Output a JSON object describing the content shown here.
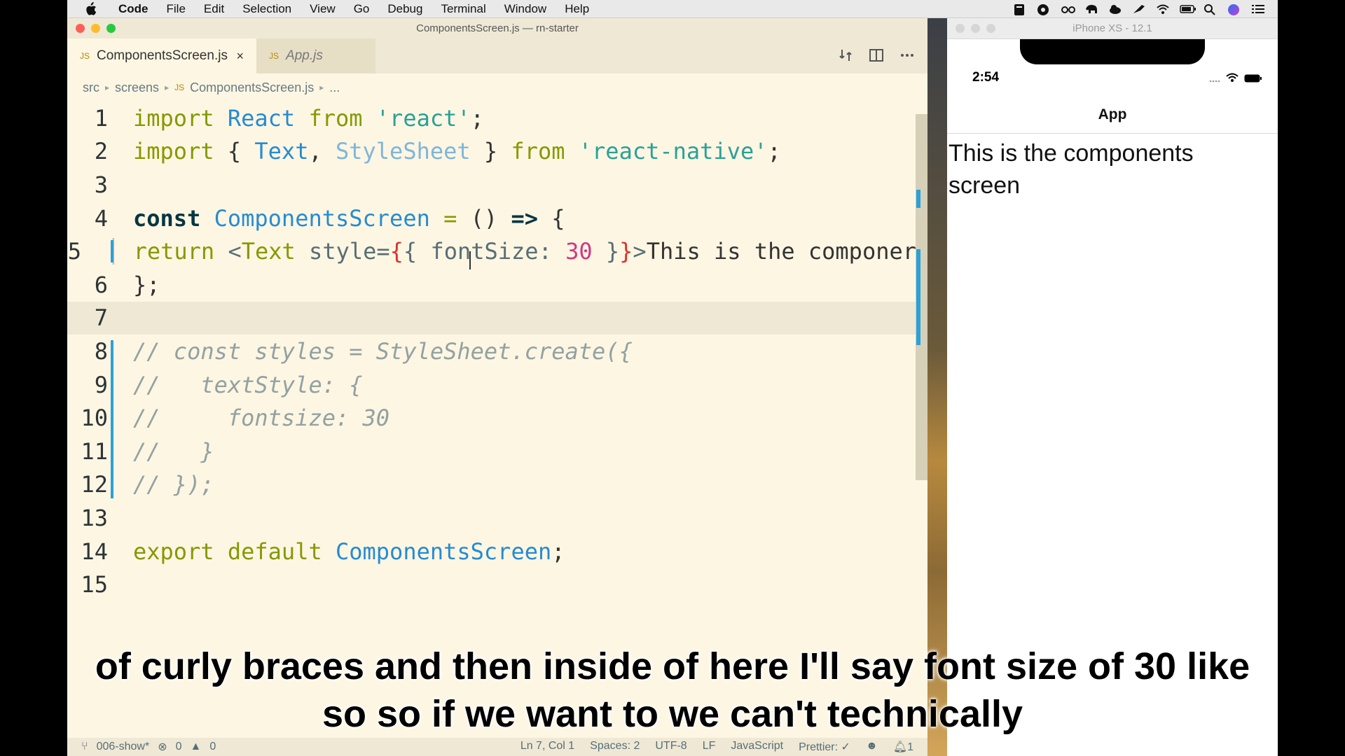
{
  "menubar": {
    "app": "Code",
    "items": [
      "File",
      "Edit",
      "Selection",
      "View",
      "Go",
      "Debug",
      "Terminal",
      "Window",
      "Help"
    ]
  },
  "editor": {
    "window_title": "ComponentsScreen.js — rn-starter",
    "tabs": [
      {
        "label": "ComponentsScreen.js",
        "close": "×"
      },
      {
        "label": "App.js"
      }
    ],
    "tab_badge": "JS",
    "breadcrumb": [
      "src",
      "screens",
      "ComponentsScreen.js",
      "..."
    ],
    "line_numbers": [
      "1",
      "2",
      "3",
      "4",
      "5",
      "6",
      "7",
      "8",
      "9",
      "10",
      "11",
      "12",
      "13",
      "14",
      "15"
    ],
    "code": {
      "l1": [
        "import",
        " React ",
        "from",
        " 'react'",
        ";"
      ],
      "l2": [
        "import",
        " { ",
        "Text",
        ", ",
        "StyleSheet",
        " } ",
        "from",
        " 'react-native'",
        ";"
      ],
      "l4": [
        "const",
        " ComponentsScreen",
        " = ",
        "() ",
        "=>",
        " {"
      ],
      "l5": [
        "return",
        " <",
        "Text",
        " style=",
        "{",
        "{ fontSize: ",
        "30",
        " }",
        "}",
        ">",
        "This is the componer"
      ],
      "l6": "};",
      "l8": "// const styles = StyleSheet.create({",
      "l9": "//   textStyle: {",
      "l10": "//     fontsize: 30",
      "l11": "//   }",
      "l12": "// });",
      "l14": [
        "export",
        " default",
        " ComponentsScreen",
        ";"
      ]
    },
    "status": {
      "branch": "006-show*",
      "errors": "0",
      "warnings": "0",
      "position": "Ln 7, Col 1",
      "spaces": "Spaces: 2",
      "encoding": "UTF-8",
      "eol": "LF",
      "language": "JavaScript",
      "prettier": "Prettier: ✓",
      "notifications": "1"
    }
  },
  "simulator": {
    "title": "iPhone XS - 12.1",
    "time": "2:54",
    "nav_title": "App",
    "screen_text": "This is the components screen"
  },
  "subtitles": {
    "line1": "of curly braces and then inside of here I'll say font size of 30 like",
    "line2": "so so if we want to we can't technically"
  },
  "colors": {
    "editor_bg": "#fdf6e3",
    "accent_bar": "#2aa1d8",
    "keyword": "#859900",
    "string": "#2aa198",
    "number": "#d33682"
  }
}
